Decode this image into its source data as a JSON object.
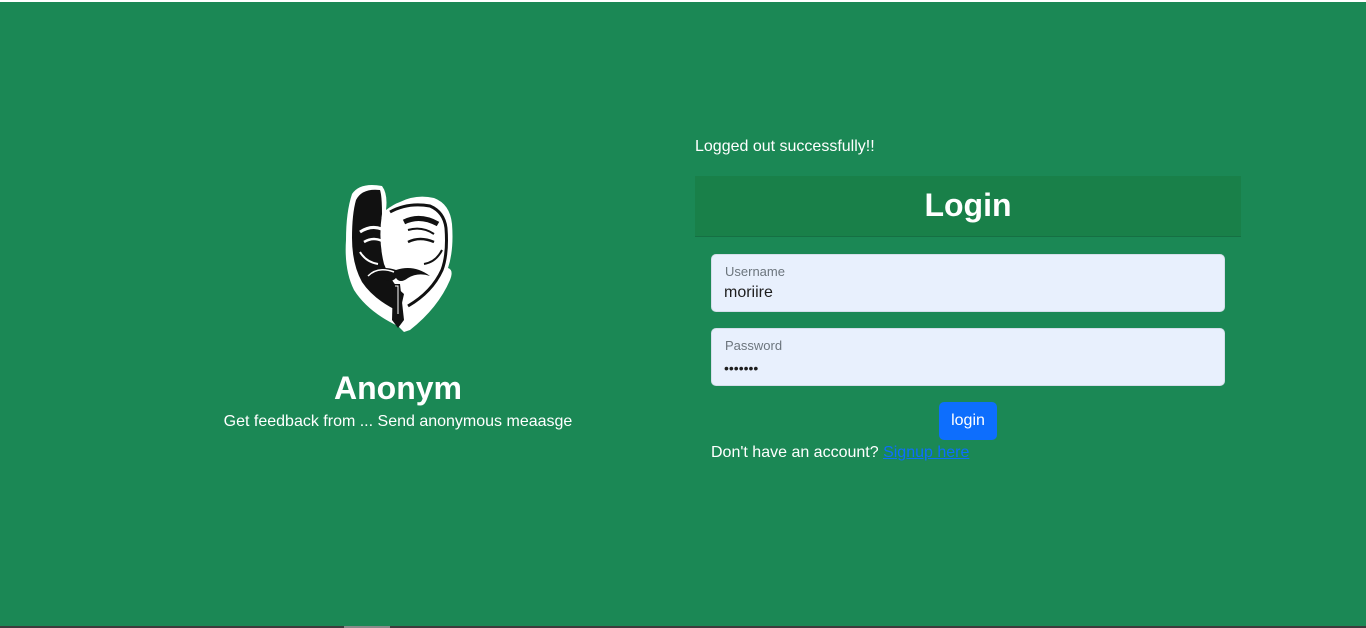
{
  "brand": {
    "name": "Anonym",
    "tagline": "Get feedback from ... Send anonymous meaasge",
    "logo_icon": "anonymous-mask-icon"
  },
  "flash": {
    "message": "Logged out successfully!!"
  },
  "login": {
    "title": "Login",
    "username_label": "Username",
    "username_value": "moriire",
    "password_label": "Password",
    "password_value": "•••••••",
    "submit_label": "login",
    "signup_prompt": "Don't have an account?",
    "signup_link": "Signup here"
  },
  "colors": {
    "background": "#1b8855",
    "header": "#198049",
    "input_bg": "#e8f0fd",
    "button": "#0d6efd",
    "link": "#0d6efd"
  }
}
